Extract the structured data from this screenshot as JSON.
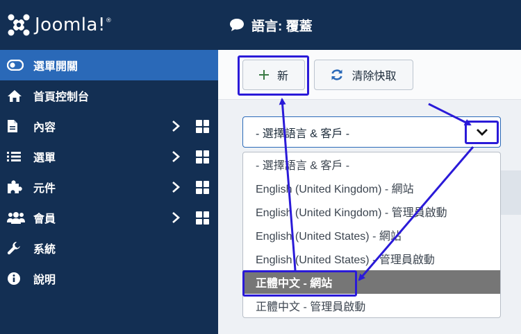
{
  "brand": {
    "name": "Joomla!"
  },
  "sidebar": {
    "items": [
      {
        "label": "選單開關",
        "icon": "toggle-icon",
        "active": true,
        "has_submenu": false
      },
      {
        "label": "首頁控制台",
        "icon": "home-icon",
        "active": false,
        "has_submenu": false
      },
      {
        "label": "內容",
        "icon": "file-icon",
        "active": false,
        "has_submenu": true
      },
      {
        "label": "選單",
        "icon": "list-icon",
        "active": false,
        "has_submenu": true
      },
      {
        "label": "元件",
        "icon": "puzzle-icon",
        "active": false,
        "has_submenu": true
      },
      {
        "label": "會員",
        "icon": "users-icon",
        "active": false,
        "has_submenu": true
      },
      {
        "label": "系統",
        "icon": "wrench-icon",
        "active": false,
        "has_submenu": false
      },
      {
        "label": "說明",
        "icon": "info-icon",
        "active": false,
        "has_submenu": false
      }
    ]
  },
  "header": {
    "title": "語言: 覆蓋",
    "icon": "comment-icon"
  },
  "toolbar": {
    "new_label": "新",
    "clear_cache_label": "清除快取"
  },
  "language_select": {
    "selected": "- 選擇語言 & 客戶 -",
    "options": [
      "- 選擇語言 & 客戶 -",
      "English (United Kingdom) - 網站",
      "English (United Kingdom) - 管理員啟動",
      "English (United States) - 網站",
      "English (United States) - 管理員啟動",
      "正體中文 - 網站",
      "正體中文 - 管理員啟動"
    ],
    "highlighted_index": 5
  },
  "colors": {
    "sidebar_bg": "#132f53",
    "active_item": "#2a69b8",
    "annotation": "#2a1ad8",
    "highlight_option": "#767676",
    "new_icon": "#3a7a44",
    "refresh_icon": "#2a69b8"
  }
}
